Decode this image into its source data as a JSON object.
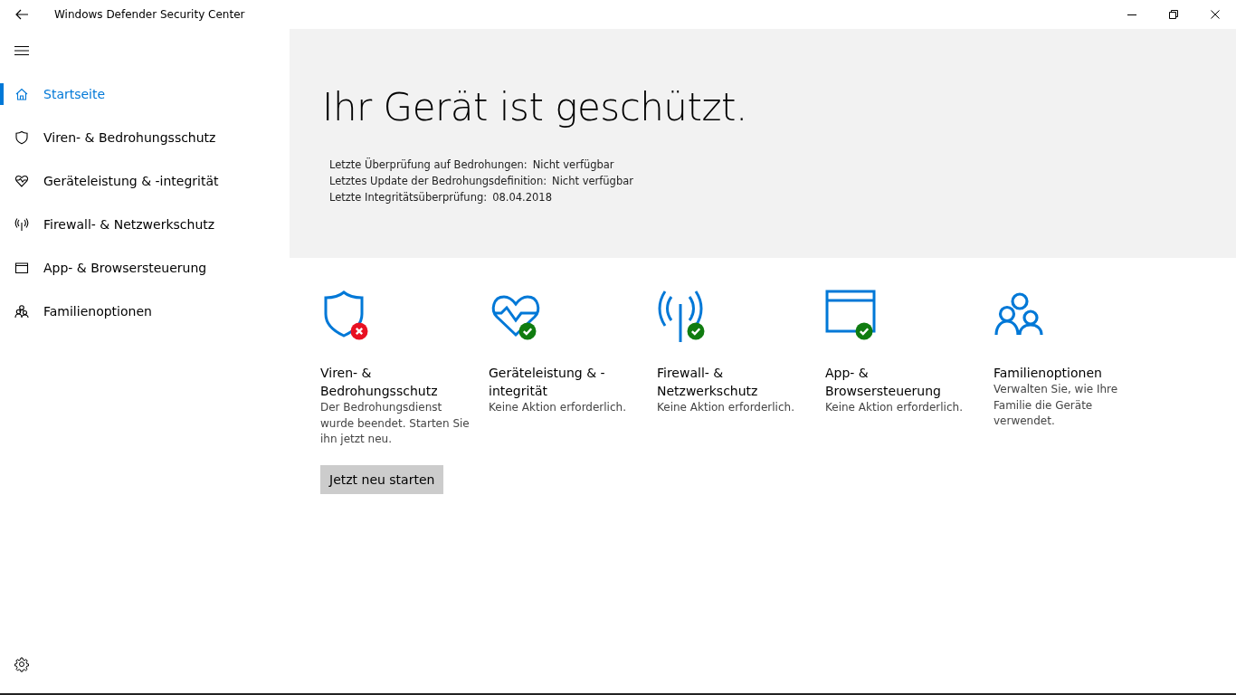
{
  "window": {
    "title": "Windows Defender Security Center"
  },
  "sidebar": {
    "items": [
      {
        "label": "Startseite",
        "kind": "home",
        "selected": true
      },
      {
        "label": "Viren- & Bedrohungsschutz",
        "kind": "virus",
        "selected": false
      },
      {
        "label": "Geräteleistung & -integrität",
        "kind": "health",
        "selected": false
      },
      {
        "label": "Firewall- & Netzwerkschutz",
        "kind": "network",
        "selected": false
      },
      {
        "label": "App- & Browsersteuerung",
        "kind": "app",
        "selected": false
      },
      {
        "label": "Familienoptionen",
        "kind": "family",
        "selected": false
      }
    ]
  },
  "hero": {
    "heading": "Ihr Gerät ist geschützt.",
    "details": [
      {
        "label": "Letzte Überprüfung auf Bedrohungen:",
        "value": "Nicht verfügbar"
      },
      {
        "label": "Letztes Update der Bedrohungsdefinition:",
        "value": "Nicht verfügbar"
      },
      {
        "label": "Letzte Integritätsüberprüfung:",
        "value": "08.04.2018"
      }
    ]
  },
  "tiles": [
    {
      "kind": "virus",
      "alert": true,
      "title": "Viren- & Bedrohungsschutz",
      "description": "Der Bedrohungsdienst wurde beendet. Starten Sie ihn jetzt neu.",
      "button": "Jetzt neu starten"
    },
    {
      "kind": "health",
      "alert": false,
      "title": "Geräteleistung & -integrität",
      "description": "Keine Aktion erforderlich."
    },
    {
      "kind": "network",
      "alert": false,
      "title": "Firewall- & Netzwerkschutz",
      "description": "Keine Aktion erforderlich."
    },
    {
      "kind": "app",
      "alert": false,
      "title": "App- & Browsersteuerung",
      "description": "Keine Aktion erforderlich."
    },
    {
      "kind": "family",
      "title": "Familienoptionen",
      "description": "Verwalten Sie, wie Ihre Familie die Geräte verwendet."
    }
  ]
}
